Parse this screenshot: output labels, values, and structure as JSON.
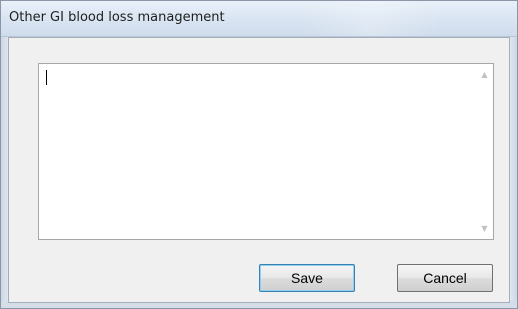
{
  "window": {
    "title": "Other GI blood loss management"
  },
  "notes": {
    "value": "",
    "scroll_up_icon": "scroll-up-arrow",
    "scroll_down_icon": "scroll-down-arrow"
  },
  "buttons": {
    "save_label": "Save",
    "cancel_label": "Cancel"
  },
  "glyphs": {
    "up": "▲",
    "down": "▼"
  }
}
